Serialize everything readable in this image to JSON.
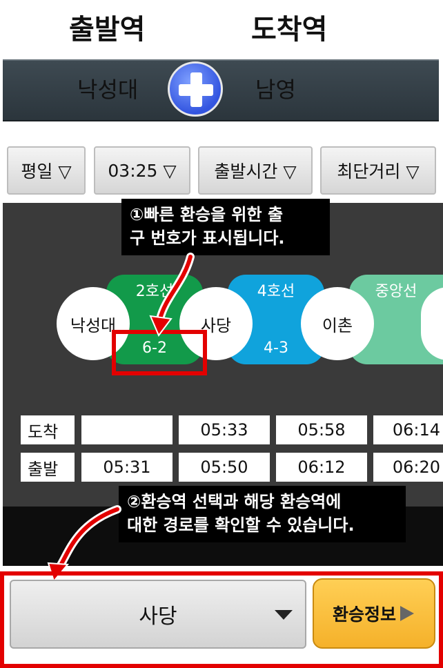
{
  "header": {
    "departure_label": "출발역",
    "arrival_label": "도착역",
    "departure_station": "낙성대",
    "arrival_station": "남영"
  },
  "options": {
    "day": "평일 ▽",
    "time": "03:25 ▽",
    "mode": "출발시간 ▽",
    "route": "최단거리 ▽"
  },
  "route_map": {
    "lines": [
      {
        "name": "2호선",
        "exit": "6-2",
        "color": "#129a4a"
      },
      {
        "name": "4호선",
        "exit": "4-3",
        "color": "#10a3dc"
      },
      {
        "name": "중앙선",
        "exit": "",
        "color": "#6ccaa0"
      }
    ],
    "stations": [
      "낙성대",
      "사당",
      "이촌"
    ]
  },
  "timetable": {
    "arrive_label": "도착",
    "depart_label": "출발",
    "arrive_times": [
      "",
      "05:33",
      "05:58",
      "06:14"
    ],
    "depart_times": [
      "05:31",
      "05:50",
      "06:12",
      "06:20"
    ]
  },
  "annotations": {
    "note1_line1": "①빠른 환승을 위한 출",
    "note1_line2": "구 번호가 표시됩니다.",
    "note2_line1": "②환승역 선택과 해당 환승역에",
    "note2_line2": "대한 경로를 확인할 수 있습니다."
  },
  "bottom": {
    "transfer_station": "사당",
    "info_button": "환승정보"
  },
  "colors": {
    "highlight": "#e30000",
    "info_button": "#f5b12a",
    "swap_button": "#3355e0"
  }
}
